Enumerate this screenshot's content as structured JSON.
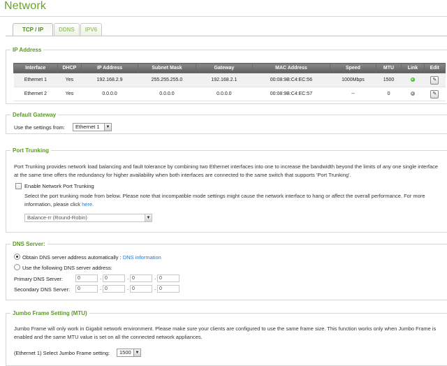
{
  "page": {
    "title": "Network"
  },
  "tabs": [
    {
      "label": "TCP / IP",
      "active": true
    },
    {
      "label": "DDNS",
      "active": false
    },
    {
      "label": "IPV6",
      "active": false
    }
  ],
  "ip_address": {
    "section_title": "IP Address",
    "columns": [
      "Interface",
      "DHCP",
      "IP Address",
      "Subnet Mask",
      "Gateway",
      "MAC Address",
      "Speed",
      "MTU",
      "Link",
      "Edit"
    ],
    "rows": [
      {
        "interface": "Ethernet 1",
        "dhcp": "Yes",
        "ip": "192.168.2.9",
        "mask": "255.255.255.0",
        "gateway": "192.168.2.1",
        "mac": "00:08:9B:C4:EC:56",
        "speed": "1000Mbps",
        "mtu": "1500",
        "link_color": "#3fbf24"
      },
      {
        "interface": "Ethernet 2",
        "dhcp": "Yes",
        "ip": "0.0.0.0",
        "mask": "0.0.0.0",
        "gateway": "0.0.0.0",
        "mac": "00:08:9B:C4:EC:57",
        "speed": "--",
        "mtu": "0",
        "link_color": "#8c8c8c"
      }
    ],
    "edit_icon": "pencil-edit-icon"
  },
  "default_gateway": {
    "section_title": "Default Gateway",
    "label": "Use the settings from:",
    "selected": "Ethernet 1"
  },
  "port_trunking": {
    "section_title": "Port Trunking",
    "description": "Port Trunking provides network load balancing and fault tolerance by combining two Ethernet interfaces into one to increase the bandwidth beyond the limits of any one single interface at the same time offers the redundancy for higher availability when both interfaces are connected to the same switch that supports 'Port Trunking'.",
    "checkbox_label": "Enable Network Port Trunking",
    "mode_help_prefix": "Select the port trunking mode from below. Please note that incompatible mode settings might cause the network interface to hang or affect the overall performance. For more information, please click",
    "mode_help_link": "here.",
    "mode_selected": "Balance-rr (Round-Robin)"
  },
  "dns": {
    "section_title": "DNS Server:",
    "auto_label": "Obtain DNS server address automatically :",
    "auto_link": "DNS information",
    "manual_label": "Use the following DNS server address:",
    "primary_label": "Primary DNS Server:",
    "secondary_label": "Secondary DNS Server:",
    "primary": [
      "0",
      "0",
      "0",
      "0"
    ],
    "secondary": [
      "0",
      "0",
      "0",
      "0"
    ]
  },
  "jumbo": {
    "section_title": "Jumbo Frame Setting (MTU)",
    "description": "Jumbo Frame will only work in Gigabit network environment. Please make sure your clients are configured to use the same frame size. This function works only when Jumbo Frame is enabled and the same MTU value is set on all the connected network appliances.",
    "select_label": "(Ethernet 1) Select Jumbo Frame setting:",
    "selected": "1500"
  },
  "colors": {
    "accent_green": "#6aa12b",
    "link_blue": "#2a73c9",
    "header_gray": "#6e6e6e"
  }
}
